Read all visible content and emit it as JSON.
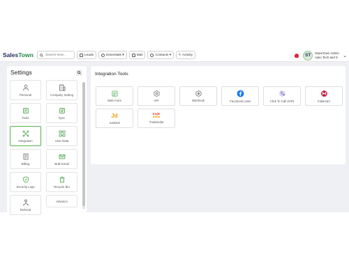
{
  "brand": {
    "part1": "Sales",
    "part2": "Town"
  },
  "search": {
    "placeholder": "Search here.."
  },
  "nav": [
    {
      "label": "Leads"
    },
    {
      "label": "Essentials ▾"
    },
    {
      "label": "Mail"
    },
    {
      "label": "Contacts ▾"
    },
    {
      "label": "Activity"
    }
  ],
  "user": {
    "initials": "ST",
    "name": "SalesTown Admin",
    "company": "Ayko Tech and S"
  },
  "settings": {
    "title": "Settings",
    "items": [
      {
        "label": "Personal",
        "icon": "person-icon"
      },
      {
        "label": "Company Setting",
        "icon": "building-icon"
      },
      {
        "label": "Tools",
        "icon": "tools-icon"
      },
      {
        "label": "Sync",
        "icon": "sync-icon"
      },
      {
        "label": "Integration",
        "icon": "integration-icon"
      },
      {
        "label": "User Data",
        "icon": "user-data-icon"
      },
      {
        "label": "Billing",
        "icon": "billing-icon"
      },
      {
        "label": "Bulk Email",
        "icon": "bulk-email-icon"
      },
      {
        "label": "Security Logs",
        "icon": "shield-icon"
      },
      {
        "label": "Recycle Bin",
        "icon": "trash-icon"
      },
      {
        "label": "Referral",
        "icon": "referral-icon"
      },
      {
        "label": "Advance",
        "icon": ""
      }
    ],
    "active": "Integration"
  },
  "integration": {
    "title": "Integration Tools",
    "items": [
      {
        "label": "Web Form",
        "icon": "web-form-icon"
      },
      {
        "label": "API",
        "icon": "api-icon"
      },
      {
        "label": "Webhook",
        "icon": "webhook-icon"
      },
      {
        "label": "Facebook Lead",
        "icon": "facebook-icon"
      },
      {
        "label": "Click To Call (IVR)",
        "icon": "phone-icon"
      },
      {
        "label": "Indiamart",
        "icon": "indiamart-icon"
      },
      {
        "label": "JustDial",
        "icon": "justdial-icon"
      },
      {
        "label": "TradeIndia",
        "icon": "tradeindia-icon"
      }
    ],
    "logo_text": {
      "justdial": "Jd",
      "tradeindia_1": "trade",
      "tradeindia_2": "india"
    }
  },
  "colors": {
    "accent_green": "#56b04f",
    "brand_navy": "#1c2a5a",
    "facebook_blue": "#1877f2",
    "bell_red": "#e0283c",
    "indiamart_red": "#c2183c"
  }
}
